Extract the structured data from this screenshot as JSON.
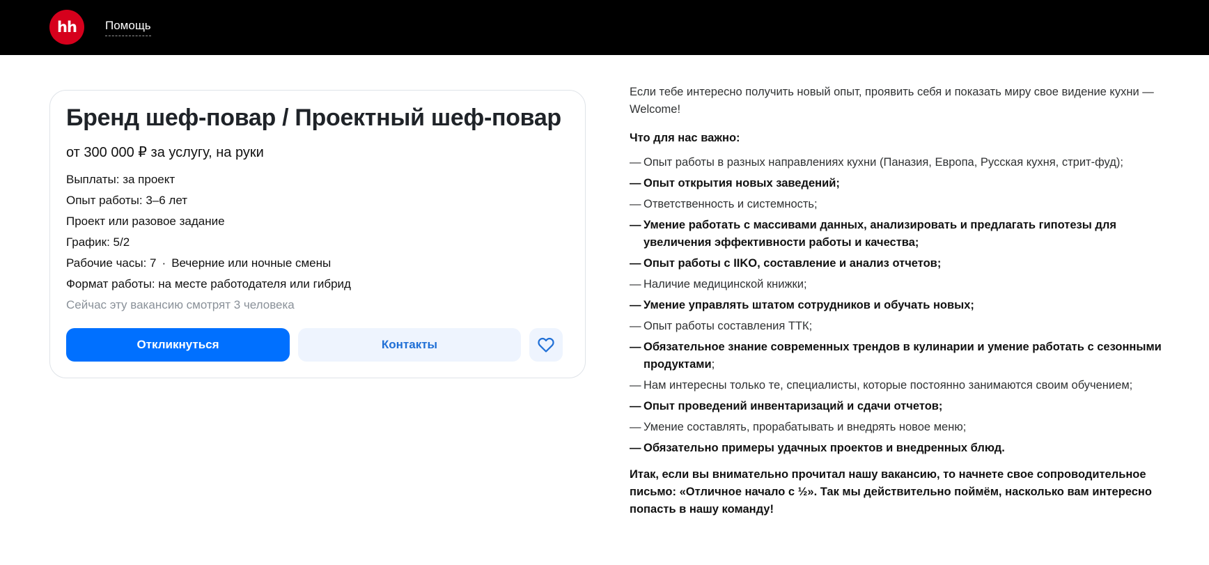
{
  "header": {
    "logo_text": "hh",
    "help_label": "Помощь"
  },
  "vacancy": {
    "title": "Бренд шеф-повар / Проектный шеф-повар",
    "salary": "от 300 000 ₽ за услугу, на руки",
    "payouts": "Выплаты: за проект",
    "experience": "Опыт работы: 3–6 лет",
    "employment": "Проект или разовое задание",
    "schedule": "График: 5/2",
    "hours": "Рабочие часы: 7",
    "hours_separator": "·",
    "shifts": "Вечерние или ночные смены",
    "work_format": "Формат работы: на месте работодателя или гибрид",
    "viewers": "Сейчас эту вакансию смотрят 3 человека",
    "apply_label": "Откликнуться",
    "contacts_label": "Контакты",
    "favorite_icon": "heart-icon"
  },
  "description": {
    "intro": "Если тебе интересно получить новый опыт, проявить себя и показать миру свое видение кухни — Welcome!",
    "subhead": "Что для нас важно:",
    "dash": "—",
    "items": [
      {
        "text": "Опыт работы в разных направлениях кухни (Паназия, Европа, Русская кухня, стрит-фуд);",
        "tail": ""
      },
      {
        "text": "Опыт открытия новых заведений;",
        "tail": ""
      },
      {
        "text": "Ответственность и системность;",
        "tail": ""
      },
      {
        "text": "Умение работать с массивами данных, анализировать и предлагать гипотезы для увеличения эффективности работы и качества;",
        "tail": ""
      },
      {
        "text": "Опыт работы с IIKO, составление и анализ отчетов;",
        "tail": ""
      },
      {
        "text": "Наличие медицинской книжки;",
        "tail": ""
      },
      {
        "text": "Умение управлять штатом сотрудников и обучать новых;",
        "tail": ""
      },
      {
        "text": "Опыт работы составления ТТК;",
        "tail": ""
      },
      {
        "text": "Обязательное знание современных трендов в кулинарии и умение работать с сезонными продуктами",
        "tail": ";"
      },
      {
        "text": "Нам интересны только те, специалисты, которые постоянно занимаются своим обучением;",
        "tail": ""
      },
      {
        "text": "Опыт проведений инвентаризаций и сдачи отчетов;",
        "tail": ""
      },
      {
        "text": "Умение составлять, прорабатывать и внедрять новое меню;",
        "tail": ""
      },
      {
        "text": "Обязательно примеры удачных проектов и внедренных блюд.",
        "tail": ""
      }
    ],
    "outro": "Итак, если вы внимательно прочитал нашу вакансию, то начнете свое сопроводительное письмо: «Отличное начало с ½». Так мы действительно поймём, насколько вам интересно попасть в нашу команду!"
  },
  "colors": {
    "brand_red": "#d6001c",
    "primary_blue": "#0070ff",
    "secondary_bg": "#eef4fe"
  }
}
